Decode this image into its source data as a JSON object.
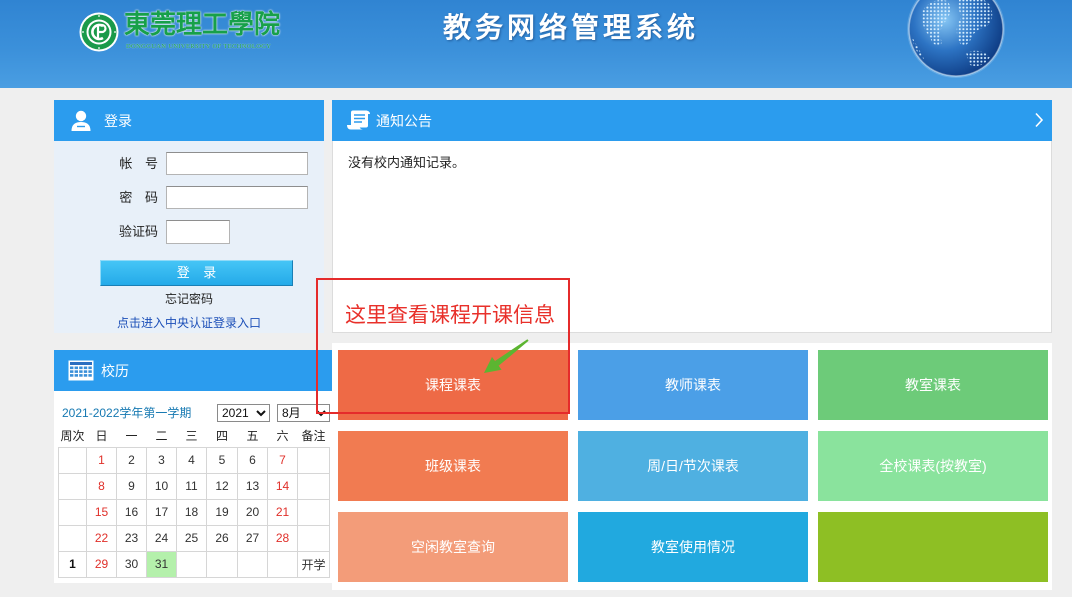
{
  "header": {
    "school_name": "東莞理工學院",
    "school_name_en": "DONGGUAN UNIVERSITY OF TECHNOLOGY",
    "system_title": "教务网络管理系统"
  },
  "login": {
    "title": "登录",
    "account_label": "帐 号",
    "account_value": "",
    "password_label": "密 码",
    "password_value": "",
    "captcha_label": "验证码",
    "captcha_value": "",
    "submit_label": "登 录",
    "forgot_password": "忘记密码",
    "cas_login_link": "点击进入中央认证登录入口"
  },
  "notice": {
    "title": "通知公告",
    "empty_message": "没有校内通知记录。"
  },
  "calendar": {
    "title": "校历",
    "term": "2021-2022学年第一学期",
    "year_select": "2021",
    "month_select": "8月",
    "headers": [
      "周次",
      "日",
      "一",
      "二",
      "三",
      "四",
      "五",
      "六",
      "备注"
    ],
    "rows": [
      {
        "week": "",
        "days": [
          "1",
          "2",
          "3",
          "4",
          "5",
          "6",
          "7"
        ],
        "note": ""
      },
      {
        "week": "",
        "days": [
          "8",
          "9",
          "10",
          "11",
          "12",
          "13",
          "14"
        ],
        "note": ""
      },
      {
        "week": "",
        "days": [
          "15",
          "16",
          "17",
          "18",
          "19",
          "20",
          "21"
        ],
        "note": ""
      },
      {
        "week": "",
        "days": [
          "22",
          "23",
          "24",
          "25",
          "26",
          "27",
          "28"
        ],
        "note": ""
      },
      {
        "week": "1",
        "days": [
          "29",
          "30",
          "31",
          "",
          "",
          "",
          ""
        ],
        "note": "开学"
      }
    ],
    "highlighted_day": 31
  },
  "tiles": [
    {
      "label": "课程课表",
      "color": "#ee6a46"
    },
    {
      "label": "教师课表",
      "color": "#4b9fe7"
    },
    {
      "label": "教室课表",
      "color": "#6dcb79"
    },
    {
      "label": "班级课表",
      "color": "#f17b51"
    },
    {
      "label": "周/日/节次课表",
      "color": "#4fb0e1"
    },
    {
      "label": "全校课表(按教室)",
      "color": "#8ae39d"
    },
    {
      "label": "空闲教室查询",
      "color": "#f39c79"
    },
    {
      "label": "教室使用情况",
      "color": "#21a9df"
    },
    {
      "color": "#8ebf24"
    }
  ],
  "annotation": {
    "text": "这里查看课程开课信息"
  },
  "colors": {
    "panel_header": "#2b9cee",
    "weekend": "#e0302a",
    "highlight": "#b4f0ab",
    "link": "#1c4fb8",
    "annotation": "#e8302a",
    "arrow": "#5cb531"
  }
}
